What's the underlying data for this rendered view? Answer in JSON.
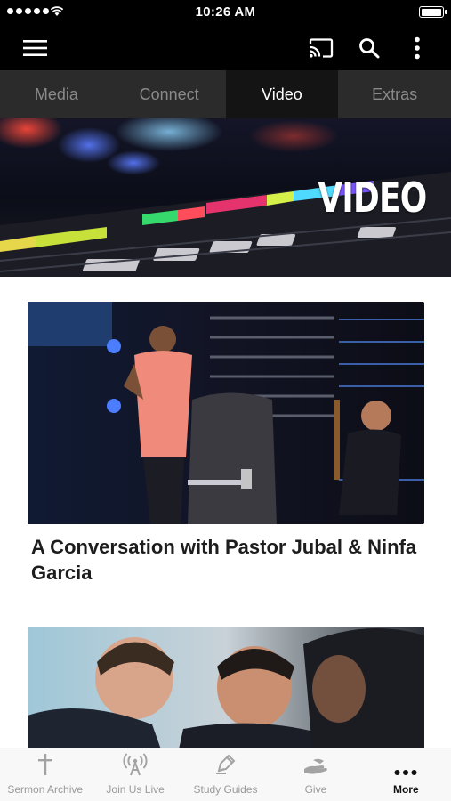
{
  "status_bar": {
    "time": "10:26 AM"
  },
  "app_bar": {
    "icons": [
      "menu-icon",
      "cast-icon",
      "search-icon",
      "more-vert-icon"
    ]
  },
  "tabs": [
    {
      "label": "Media",
      "active": false
    },
    {
      "label": "Connect",
      "active": false
    },
    {
      "label": "Video",
      "active": true
    },
    {
      "label": "Extras",
      "active": false
    }
  ],
  "hero": {
    "title": "VIDEO"
  },
  "cards": [
    {
      "title": "A Conversation with Pastor Jubal & Ninfa Garcia"
    },
    {
      "title": ""
    }
  ],
  "bottom_nav": [
    {
      "label": "Sermon Archive",
      "icon": "cross-icon",
      "active": false
    },
    {
      "label": "Join Us Live",
      "icon": "broadcast-icon",
      "active": false
    },
    {
      "label": "Study Guides",
      "icon": "pen-icon",
      "active": false
    },
    {
      "label": "Give",
      "icon": "hand-icon",
      "active": false
    },
    {
      "label": "More",
      "icon": "more-horiz-icon",
      "active": true
    }
  ],
  "colors": {
    "status_bar_bg": "#000000",
    "tab_bg": "#2b2b2b",
    "tab_active_bg": "#141414",
    "tab_inactive_text": "#8a8a8a",
    "bottom_bar_bg": "#f8f8f8"
  }
}
